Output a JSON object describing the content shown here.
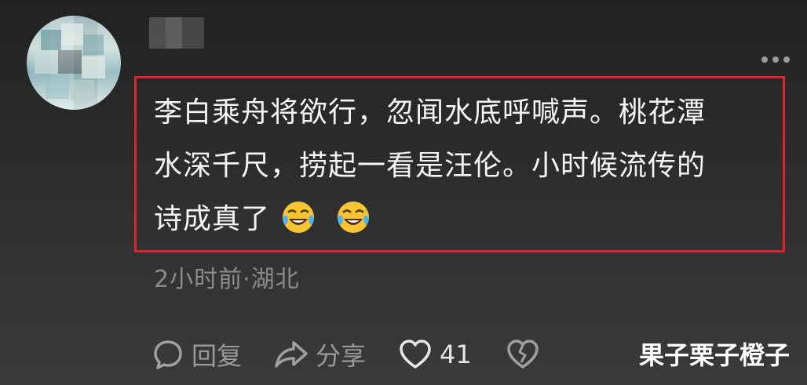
{
  "comment": {
    "lines": [
      "李白乘舟将欲行，忽闻水底呼喊声。桃花潭",
      "水深千尺，捞起一看是汪伦。小时候流传的",
      "诗成真了"
    ],
    "emojis": [
      "laughing-crying-emoji",
      "laughing-crying-emoji"
    ]
  },
  "meta": {
    "time_location": "2小时前·湖北"
  },
  "actions": {
    "reply_label": "回复",
    "share_label": "分享",
    "like_count": "41"
  },
  "watermark": "果子栗子橙子",
  "colors": {
    "highlight_border": "#e0242d",
    "secondary_text": "#8c8c8c"
  }
}
